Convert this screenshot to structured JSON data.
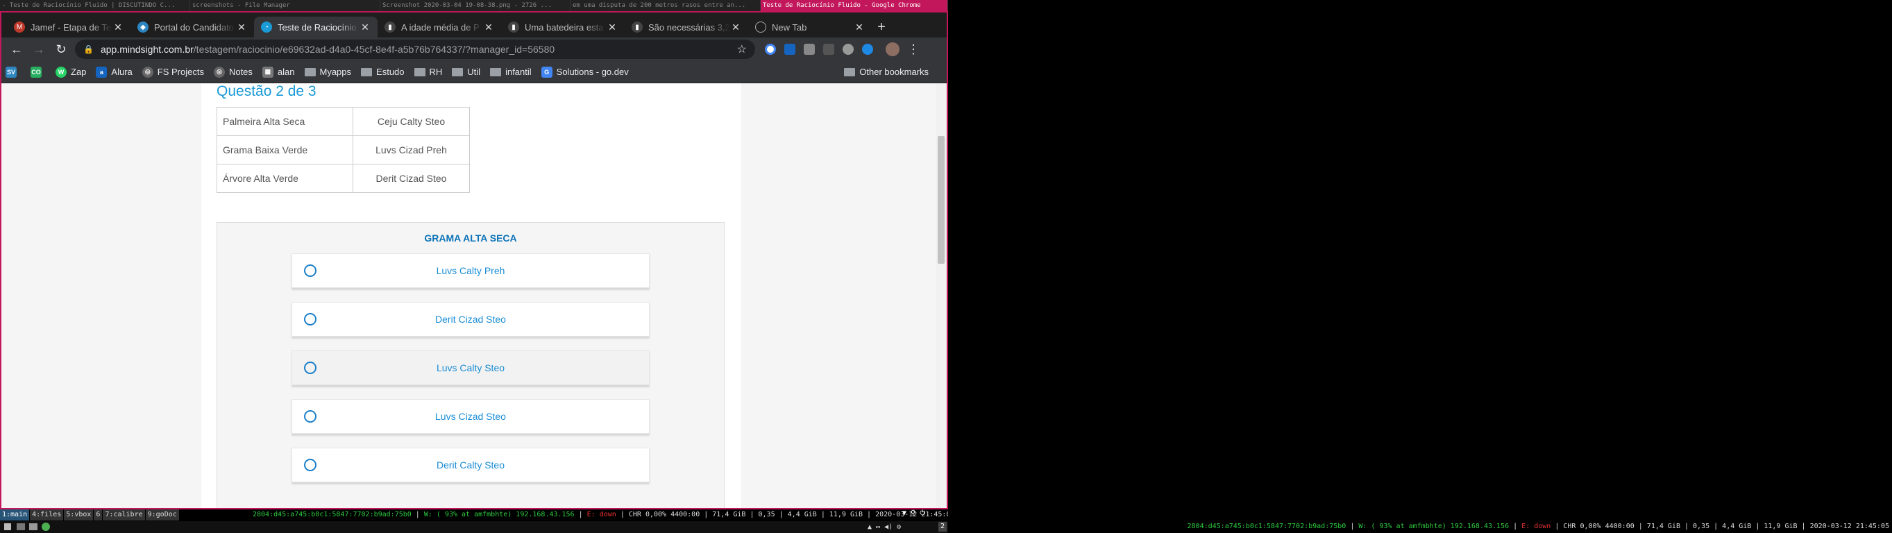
{
  "wm": {
    "titles": [
      "- Teste de Raciocínio Fluido | DISCUTINDO C...",
      "screenshots - File Manager",
      "Screenshot 2020-03-04 19-08-38.png - 2726 ...",
      "em uma disputa de 200 metros rasos entre an...",
      "Teste de Raciocínio Fluido - Google Chrome"
    ]
  },
  "browser": {
    "tabs": [
      {
        "label": "Jamef - Etapa de Te",
        "color": "#c0392b",
        "icon": "gmail-icon"
      },
      {
        "label": "Portal do Candidato",
        "color": "#2e86c1",
        "icon": "portal-icon"
      },
      {
        "label": "Teste de Raciocínio",
        "color": "#1a9ad6",
        "icon": "mindsight-icon"
      },
      {
        "label": "A idade média de P",
        "color": "#555555",
        "icon": "bookmark-icon"
      },
      {
        "label": "Uma batedeira esta",
        "color": "#555555",
        "icon": "bookmark-icon"
      },
      {
        "label": "São necessárias 3,2",
        "color": "#555555",
        "icon": "bookmark-icon"
      },
      {
        "label": "New Tab",
        "color": "#777777",
        "icon": "newtab-icon"
      }
    ],
    "url_host": "app.mindsight.com.br",
    "url_path": "/testagem/raciocinio/e69632ad-d4a0-45cf-8e4f-a5b76b764337/?manager_id=56580",
    "bookmarks": [
      {
        "label": "",
        "badge": "SV",
        "color": "#2e86c1"
      },
      {
        "label": "",
        "badge": "CO",
        "color": "#27ae60"
      },
      {
        "label": "Zap",
        "badge": "W",
        "color": "#25d366"
      },
      {
        "label": "Alura",
        "badge": "a",
        "color": "#1565c0"
      },
      {
        "label": "FS Projects",
        "badge": "◎",
        "color": "#666666"
      },
      {
        "label": "Notes",
        "badge": "◎",
        "color": "#666666"
      },
      {
        "label": "alan",
        "badge": "▦",
        "color": "#777777"
      },
      {
        "label": "Myapps",
        "folder": true
      },
      {
        "label": "Estudo",
        "folder": true
      },
      {
        "label": "RH",
        "folder": true
      },
      {
        "label": "Util",
        "folder": true
      },
      {
        "label": "infantil",
        "folder": true
      },
      {
        "label": "Solutions - go.dev",
        "badge": "G",
        "color": "#4285f4"
      }
    ],
    "other_bookmarks": "Other bookmarks"
  },
  "page": {
    "question_title": "Questão 2 de 3",
    "pairs": [
      [
        "Palmeira Alta Seca",
        "Ceju Calty Steo"
      ],
      [
        "Grama Baixa Verde",
        "Luvs Cizad Preh"
      ],
      [
        "Árvore Alta Verde",
        "Derit Cizad Steo"
      ]
    ],
    "prompt": "GRAMA ALTA SECA",
    "options": [
      "Luvs Calty Preh",
      "Derit Cizad Steo",
      "Luvs Calty Steo",
      "Luvs Cizad Steo",
      "Derit Calty Steo"
    ],
    "hovered_option": 2
  },
  "bar_left": {
    "workspaces": [
      "1:main",
      "4:files",
      "5:vbox",
      "6",
      "7:calibre",
      "9:goDoc"
    ],
    "active_workspace": "1:main",
    "ipv6": "2804:d45:a745:b0c1:5847:7702:b9ad:75b0",
    "wifi": "W: ( 93% at amfmbhte) 192.168.43.156",
    "eth": "E: down",
    "stats": "CHR 0,00% 4400:00 | 71,4 GiB | 0,35 | 4,4 GiB | 11,9 GiB | 2020-03-12 21:45:05"
  },
  "bar_right": {
    "ipv6": "2804:d45:a745:b0c1:5847:7702:b9ad:75b0",
    "wifi": "W: ( 93% at amfmbhte) 192.168.43.156",
    "eth": "E: down",
    "stats": "CHR 0,00% 4400:00 | 71,4 GiB | 0,35 | 4,4 GiB | 11,9 GiB | 2020-03-12 21:45:05"
  },
  "tray": {
    "workspace_num": "2"
  }
}
